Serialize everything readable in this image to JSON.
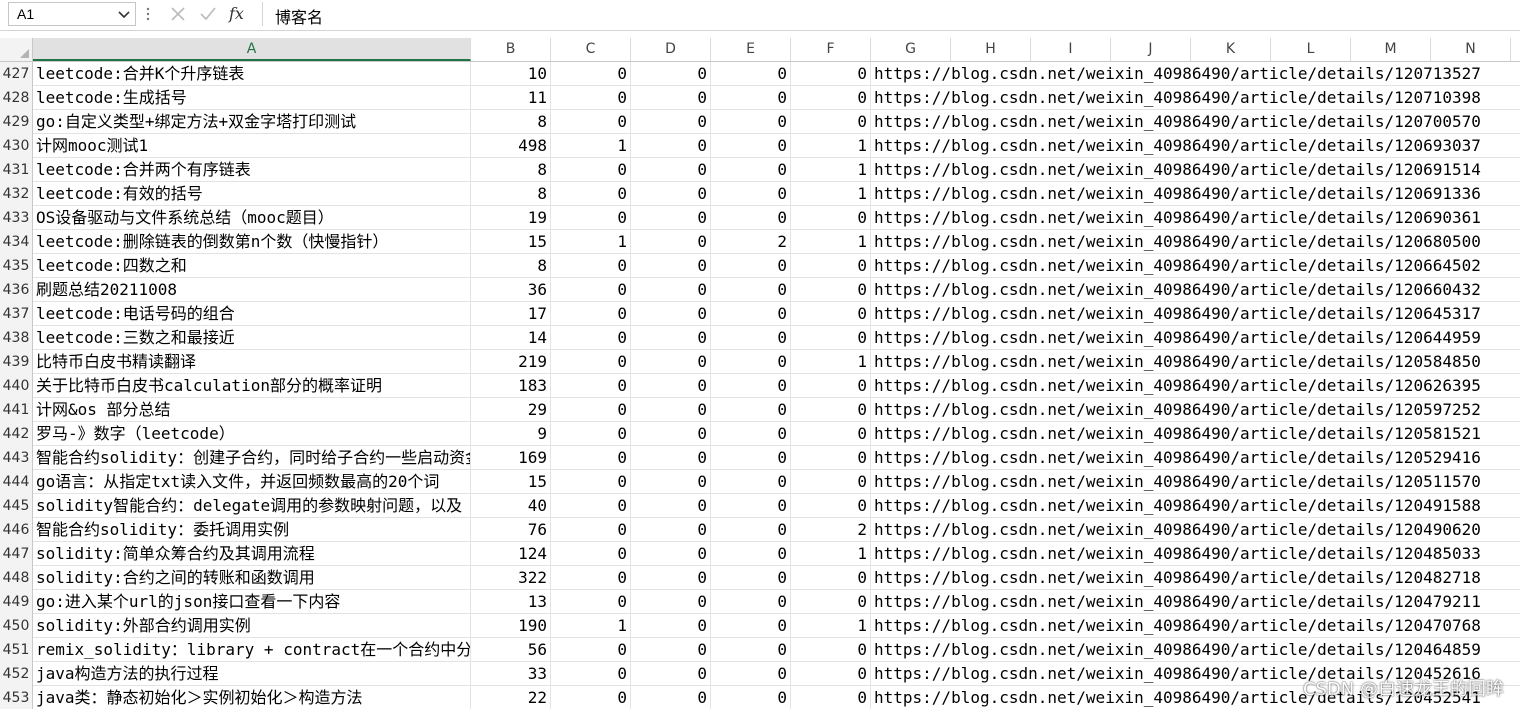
{
  "formula_bar": {
    "name_box": "A1",
    "formula": "博客名",
    "icons": [
      "chevron-down-icon",
      "more-vertical-icon",
      "cancel-icon",
      "check-icon",
      "function-icon"
    ]
  },
  "columns": [
    "A",
    "B",
    "C",
    "D",
    "E",
    "F",
    "G",
    "H",
    "I",
    "J",
    "K",
    "L",
    "M",
    "N"
  ],
  "selected_column": "A",
  "rows": [
    {
      "n": "427",
      "title": "leetcode:合并K个升序链表",
      "b": "10",
      "c": "0",
      "d": "0",
      "e": "0",
      "f": "0",
      "url": "https://blog.csdn.net/weixin_40986490/article/details/120713527"
    },
    {
      "n": "428",
      "title": "leetcode:生成括号",
      "b": "11",
      "c": "0",
      "d": "0",
      "e": "0",
      "f": "0",
      "url": "https://blog.csdn.net/weixin_40986490/article/details/120710398"
    },
    {
      "n": "429",
      "title": "go:自定义类型+绑定方法+双金字塔打印测试",
      "b": "8",
      "c": "0",
      "d": "0",
      "e": "0",
      "f": "0",
      "url": "https://blog.csdn.net/weixin_40986490/article/details/120700570"
    },
    {
      "n": "430",
      "title": "计网mooc测试1",
      "b": "498",
      "c": "1",
      "d": "0",
      "e": "0",
      "f": "1",
      "url": "https://blog.csdn.net/weixin_40986490/article/details/120693037"
    },
    {
      "n": "431",
      "title": "leetcode:合并两个有序链表",
      "b": "8",
      "c": "0",
      "d": "0",
      "e": "0",
      "f": "1",
      "url": "https://blog.csdn.net/weixin_40986490/article/details/120691514"
    },
    {
      "n": "432",
      "title": "leetcode:有效的括号",
      "b": "8",
      "c": "0",
      "d": "0",
      "e": "0",
      "f": "1",
      "url": "https://blog.csdn.net/weixin_40986490/article/details/120691336"
    },
    {
      "n": "433",
      "title": "OS设备驱动与文件系统总结（mooc题目）",
      "b": "19",
      "c": "0",
      "d": "0",
      "e": "0",
      "f": "0",
      "url": "https://blog.csdn.net/weixin_40986490/article/details/120690361"
    },
    {
      "n": "434",
      "title": "leetcode:删除链表的倒数第n个数（快慢指针）",
      "b": "15",
      "c": "1",
      "d": "0",
      "e": "2",
      "f": "1",
      "url": "https://blog.csdn.net/weixin_40986490/article/details/120680500"
    },
    {
      "n": "435",
      "title": "leetcode:四数之和",
      "b": "8",
      "c": "0",
      "d": "0",
      "e": "0",
      "f": "0",
      "url": "https://blog.csdn.net/weixin_40986490/article/details/120664502"
    },
    {
      "n": "436",
      "title": "刷题总结20211008",
      "b": "36",
      "c": "0",
      "d": "0",
      "e": "0",
      "f": "0",
      "url": "https://blog.csdn.net/weixin_40986490/article/details/120660432"
    },
    {
      "n": "437",
      "title": "leetcode:电话号码的组合",
      "b": "17",
      "c": "0",
      "d": "0",
      "e": "0",
      "f": "0",
      "url": "https://blog.csdn.net/weixin_40986490/article/details/120645317"
    },
    {
      "n": "438",
      "title": "leetcode:三数之和最接近",
      "b": "14",
      "c": "0",
      "d": "0",
      "e": "0",
      "f": "0",
      "url": "https://blog.csdn.net/weixin_40986490/article/details/120644959"
    },
    {
      "n": "439",
      "title": "比特币白皮书精读翻译",
      "b": "219",
      "c": "0",
      "d": "0",
      "e": "0",
      "f": "1",
      "url": "https://blog.csdn.net/weixin_40986490/article/details/120584850"
    },
    {
      "n": "440",
      "title": "关于比特币白皮书calculation部分的概率证明",
      "b": "183",
      "c": "0",
      "d": "0",
      "e": "0",
      "f": "0",
      "url": "https://blog.csdn.net/weixin_40986490/article/details/120626395"
    },
    {
      "n": "441",
      "title": "计网&os 部分总结",
      "b": "29",
      "c": "0",
      "d": "0",
      "e": "0",
      "f": "0",
      "url": "https://blog.csdn.net/weixin_40986490/article/details/120597252"
    },
    {
      "n": "442",
      "title": "罗马-》数字（leetcode）",
      "b": "9",
      "c": "0",
      "d": "0",
      "e": "0",
      "f": "0",
      "url": "https://blog.csdn.net/weixin_40986490/article/details/120581521"
    },
    {
      "n": "443",
      "title": "智能合约solidity：创建子合约，同时给子合约一些启动资金",
      "b": "169",
      "c": "0",
      "d": "0",
      "e": "0",
      "f": "0",
      "url": "https://blog.csdn.net/weixin_40986490/article/details/120529416"
    },
    {
      "n": "444",
      "title": "go语言：从指定txt读入文件，并返回频数最高的20个词",
      "b": "15",
      "c": "0",
      "d": "0",
      "e": "0",
      "f": "0",
      "url": "https://blog.csdn.net/weixin_40986490/article/details/120511570"
    },
    {
      "n": "445",
      "title": "solidity智能合约：delegate调用的参数映射问题，以及",
      "b": "40",
      "c": "0",
      "d": "0",
      "e": "0",
      "f": "0",
      "url": "https://blog.csdn.net/weixin_40986490/article/details/120491588"
    },
    {
      "n": "446",
      "title": "智能合约solidity：委托调用实例",
      "b": "76",
      "c": "0",
      "d": "0",
      "e": "0",
      "f": "2",
      "url": "https://blog.csdn.net/weixin_40986490/article/details/120490620"
    },
    {
      "n": "447",
      "title": "solidity:简单众筹合约及其调用流程",
      "b": "124",
      "c": "0",
      "d": "0",
      "e": "0",
      "f": "1",
      "url": "https://blog.csdn.net/weixin_40986490/article/details/120485033"
    },
    {
      "n": "448",
      "title": "solidity:合约之间的转账和函数调用",
      "b": "322",
      "c": "0",
      "d": "0",
      "e": "0",
      "f": "0",
      "url": "https://blog.csdn.net/weixin_40986490/article/details/120482718"
    },
    {
      "n": "449",
      "title": "go:进入某个url的json接口查看一下内容",
      "b": "13",
      "c": "0",
      "d": "0",
      "e": "0",
      "f": "0",
      "url": "https://blog.csdn.net/weixin_40986490/article/details/120479211"
    },
    {
      "n": "450",
      "title": "solidity:外部合约调用实例",
      "b": "190",
      "c": "1",
      "d": "0",
      "e": "0",
      "f": "1",
      "url": "https://blog.csdn.net/weixin_40986490/article/details/120470768"
    },
    {
      "n": "451",
      "title": "remix_solidity：library + contract在一个合约中分开写",
      "b": "56",
      "c": "0",
      "d": "0",
      "e": "0",
      "f": "0",
      "url": "https://blog.csdn.net/weixin_40986490/article/details/120464859"
    },
    {
      "n": "452",
      "title": "java构造方法的执行过程",
      "b": "33",
      "c": "0",
      "d": "0",
      "e": "0",
      "f": "0",
      "url": "https://blog.csdn.net/weixin_40986490/article/details/120452616"
    },
    {
      "n": "453",
      "title": "java类：静态初始化＞实例初始化＞构造方法",
      "b": "22",
      "c": "0",
      "d": "0",
      "e": "0",
      "f": "0",
      "url": "https://blog.csdn.net/weixin_40986490/article/details/120452541"
    }
  ],
  "watermark": "CSDN @白速龙王的回眸"
}
